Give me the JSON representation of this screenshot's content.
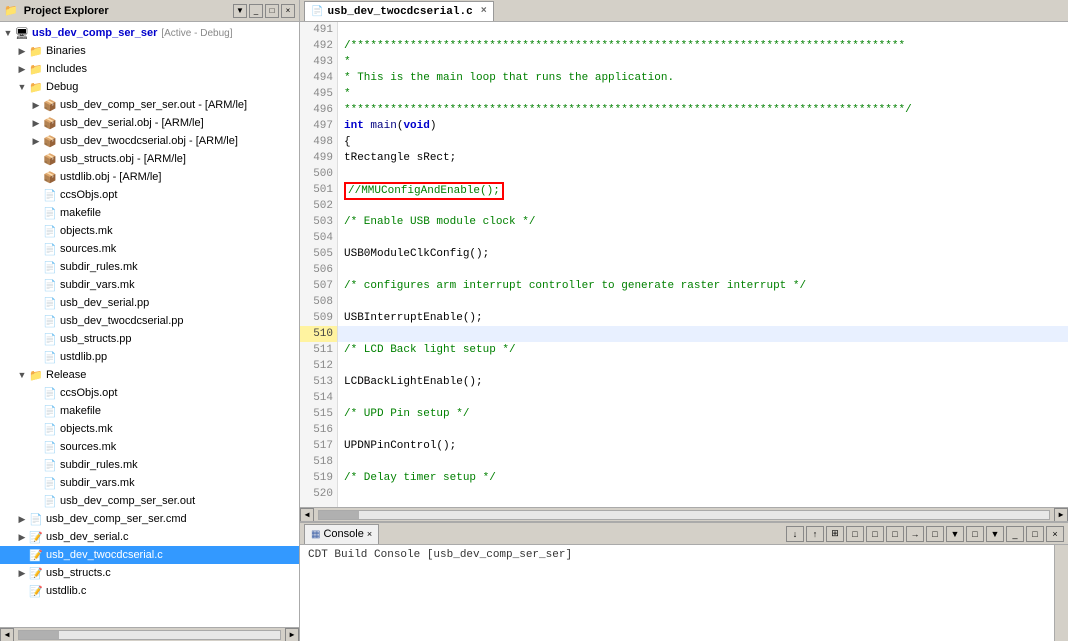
{
  "leftPanel": {
    "title": "Project Explorer",
    "tree": [
      {
        "id": "root",
        "indent": 0,
        "arrow": "expanded",
        "icon": "project",
        "label": "usb_dev_comp_ser_ser",
        "extra": "[Active - Debug]",
        "active": true
      },
      {
        "id": "binaries",
        "indent": 1,
        "arrow": "collapsed",
        "icon": "folder",
        "label": "Binaries"
      },
      {
        "id": "includes",
        "indent": 1,
        "arrow": "collapsed",
        "icon": "folder",
        "label": "Includes"
      },
      {
        "id": "debug",
        "indent": 1,
        "arrow": "expanded",
        "icon": "folder",
        "label": "Debug"
      },
      {
        "id": "debug-ser-out",
        "indent": 2,
        "arrow": "collapsed",
        "icon": "obj",
        "label": "usb_dev_comp_ser_ser.out - [ARM/le]"
      },
      {
        "id": "debug-serial-obj",
        "indent": 2,
        "arrow": "collapsed",
        "icon": "obj",
        "label": "usb_dev_serial.obj - [ARM/le]"
      },
      {
        "id": "debug-twocdcserial-obj",
        "indent": 2,
        "arrow": "collapsed",
        "icon": "obj",
        "label": "usb_dev_twocdcserial.obj - [ARM/le]"
      },
      {
        "id": "debug-structs-obj",
        "indent": 2,
        "arrow": "leaf",
        "icon": "obj",
        "label": "usb_structs.obj - [ARM/le]"
      },
      {
        "id": "debug-ustdlib-obj",
        "indent": 2,
        "arrow": "leaf",
        "icon": "obj",
        "label": "ustdlib.obj - [ARM/le]"
      },
      {
        "id": "debug-ccsObjs",
        "indent": 2,
        "arrow": "leaf",
        "icon": "file",
        "label": "ccsObjs.opt"
      },
      {
        "id": "debug-makefile",
        "indent": 2,
        "arrow": "leaf",
        "icon": "file",
        "label": "makefile"
      },
      {
        "id": "debug-objects",
        "indent": 2,
        "arrow": "leaf",
        "icon": "file",
        "label": "objects.mk"
      },
      {
        "id": "debug-sources",
        "indent": 2,
        "arrow": "leaf",
        "icon": "file",
        "label": "sources.mk"
      },
      {
        "id": "debug-subdir-rules",
        "indent": 2,
        "arrow": "leaf",
        "icon": "file",
        "label": "subdir_rules.mk"
      },
      {
        "id": "debug-subdir-vars",
        "indent": 2,
        "arrow": "leaf",
        "icon": "file",
        "label": "subdir_vars.mk"
      },
      {
        "id": "debug-usb-serial-pp",
        "indent": 2,
        "arrow": "leaf",
        "icon": "file",
        "label": "usb_dev_serial.pp"
      },
      {
        "id": "debug-usb-twocdcserial-pp",
        "indent": 2,
        "arrow": "leaf",
        "icon": "file",
        "label": "usb_dev_twocdcserial.pp"
      },
      {
        "id": "debug-usb-structs-pp",
        "indent": 2,
        "arrow": "leaf",
        "icon": "file",
        "label": "usb_structs.pp"
      },
      {
        "id": "debug-ustdlib-pp",
        "indent": 2,
        "arrow": "leaf",
        "icon": "file",
        "label": "ustdlib.pp"
      },
      {
        "id": "release",
        "indent": 1,
        "arrow": "expanded",
        "icon": "folder",
        "label": "Release"
      },
      {
        "id": "release-ccsObjs",
        "indent": 2,
        "arrow": "leaf",
        "icon": "file",
        "label": "ccsObjs.opt"
      },
      {
        "id": "release-makefile",
        "indent": 2,
        "arrow": "leaf",
        "icon": "file",
        "label": "makefile"
      },
      {
        "id": "release-objects",
        "indent": 2,
        "arrow": "leaf",
        "icon": "file",
        "label": "objects.mk"
      },
      {
        "id": "release-sources",
        "indent": 2,
        "arrow": "leaf",
        "icon": "file",
        "label": "sources.mk"
      },
      {
        "id": "release-subdir-rules",
        "indent": 2,
        "arrow": "leaf",
        "icon": "file",
        "label": "subdir_rules.mk"
      },
      {
        "id": "release-subdir-vars",
        "indent": 2,
        "arrow": "leaf",
        "icon": "file",
        "label": "subdir_vars.mk"
      },
      {
        "id": "release-comp-ser-out",
        "indent": 2,
        "arrow": "leaf",
        "icon": "file",
        "label": "usb_dev_comp_ser_ser.out"
      },
      {
        "id": "release-cmd",
        "indent": 1,
        "arrow": "collapsed",
        "icon": "file",
        "label": "usb_dev_comp_ser_ser.cmd"
      },
      {
        "id": "usb-dev-serial-c",
        "indent": 1,
        "arrow": "collapsed",
        "icon": "file-c",
        "label": "usb_dev_serial.c"
      },
      {
        "id": "usb-dev-twocdcserial-c",
        "indent": 1,
        "arrow": "leaf",
        "icon": "file-c",
        "label": "usb_dev_twocdcserial.c",
        "selected": true
      },
      {
        "id": "usb-structs-c",
        "indent": 1,
        "arrow": "collapsed",
        "icon": "file-c",
        "label": "usb_structs.c"
      },
      {
        "id": "ustdlib-c",
        "indent": 1,
        "arrow": "leaf",
        "icon": "file-c",
        "label": "ustdlib.c"
      }
    ]
  },
  "editorTab": {
    "label": "usb_dev_twocdcserial.c",
    "icon": "file-icon"
  },
  "codeLines": [
    {
      "num": 491,
      "content": "",
      "type": "plain"
    },
    {
      "num": 492,
      "content": "/************************************************************************************",
      "type": "comment"
    },
    {
      "num": 493,
      "content": " *",
      "type": "comment"
    },
    {
      "num": 494,
      "content": " *  This is the main loop that runs the application.",
      "type": "comment"
    },
    {
      "num": 495,
      "content": " *",
      "type": "comment"
    },
    {
      "num": 496,
      "content": " *************************************************************************************/",
      "type": "comment"
    },
    {
      "num": 497,
      "content": "int main(void)",
      "type": "code-main"
    },
    {
      "num": 498,
      "content": "{",
      "type": "plain"
    },
    {
      "num": 499,
      "content": "    tRectangle sRect;",
      "type": "plain"
    },
    {
      "num": 500,
      "content": "",
      "type": "plain"
    },
    {
      "num": 501,
      "content": "    //MMUConfigAndEnable();",
      "type": "commented-boxed"
    },
    {
      "num": 502,
      "content": "",
      "type": "plain"
    },
    {
      "num": 503,
      "content": "    /* Enable USB module clock */",
      "type": "comment-inline"
    },
    {
      "num": 504,
      "content": "",
      "type": "plain"
    },
    {
      "num": 505,
      "content": "    USB0ModuleClkConfig();",
      "type": "plain"
    },
    {
      "num": 506,
      "content": "",
      "type": "plain"
    },
    {
      "num": 507,
      "content": "    /* configures arm interrupt controller to generate raster interrupt   */",
      "type": "comment-inline"
    },
    {
      "num": 508,
      "content": "",
      "type": "plain"
    },
    {
      "num": 509,
      "content": "    USBInterruptEnable();",
      "type": "plain"
    },
    {
      "num": 510,
      "content": "",
      "type": "highlighted"
    },
    {
      "num": 511,
      "content": "    /* LCD Back light setup */",
      "type": "comment-inline"
    },
    {
      "num": 512,
      "content": "",
      "type": "plain"
    },
    {
      "num": 513,
      "content": "    LCDBackLightEnable();",
      "type": "plain"
    },
    {
      "num": 514,
      "content": "",
      "type": "plain"
    },
    {
      "num": 515,
      "content": "    /* UPD Pin setup */",
      "type": "comment-inline"
    },
    {
      "num": 516,
      "content": "",
      "type": "plain"
    },
    {
      "num": 517,
      "content": "    UPDNPinControl();",
      "type": "plain"
    },
    {
      "num": 518,
      "content": "",
      "type": "plain"
    },
    {
      "num": 519,
      "content": "    /* Delay timer setup */",
      "type": "comment-inline"
    },
    {
      "num": 520,
      "content": "",
      "type": "plain"
    }
  ],
  "console": {
    "title": "Console",
    "closeIcon": "×",
    "buildText": "CDT Build Console [usb_dev_comp_ser_ser]",
    "toolButtons": [
      "↓",
      "↑",
      "⊞",
      "□",
      "□",
      "□",
      "→",
      "□",
      "▼",
      "□",
      "▼",
      "□",
      "×"
    ]
  }
}
